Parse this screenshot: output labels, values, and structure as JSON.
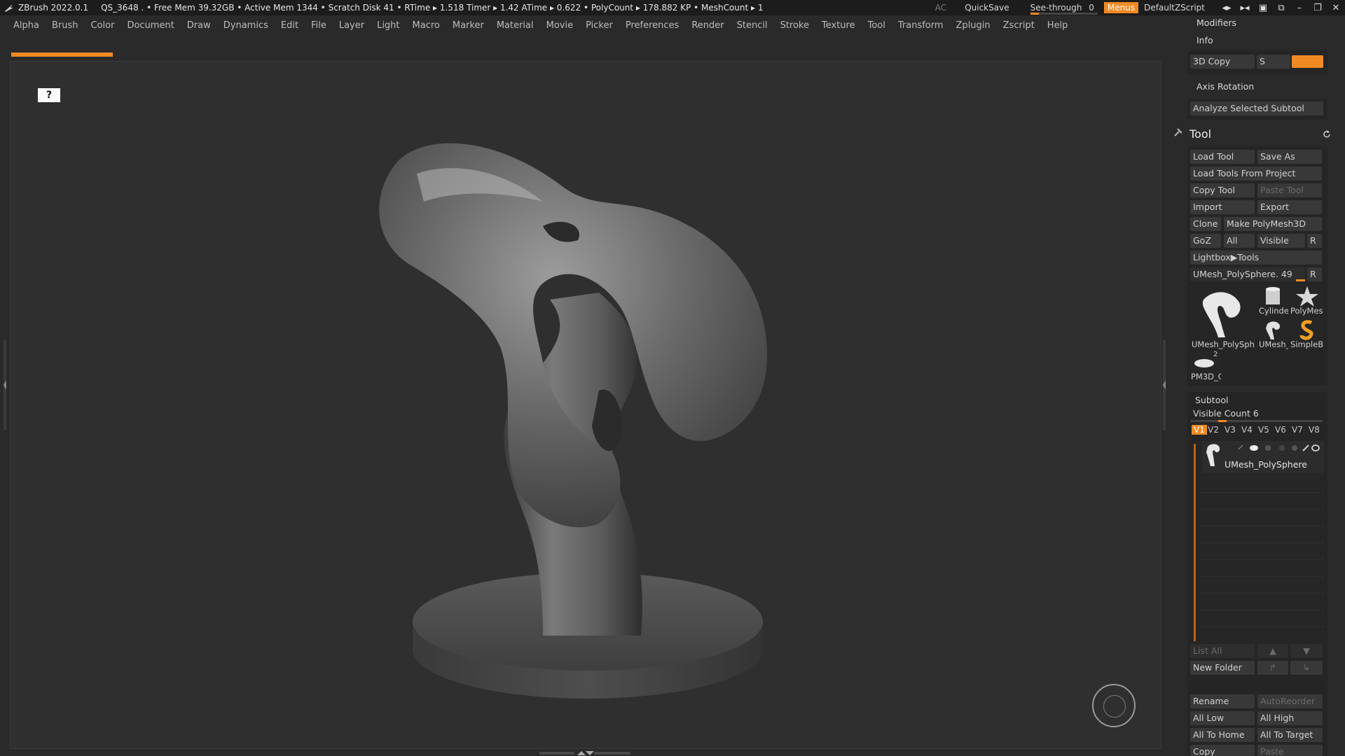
{
  "titlebar": {
    "app_title": "ZBrush 2022.0.1",
    "status": "QS_3648   . • Free Mem 39.32GB • Active Mem 1344 • Scratch Disk 41 • RTime ▸ 1.518 Timer ▸ 1.42 ATime ▸ 0.622 • PolyCount ▸ 178.882 KP • MeshCount ▸ 1",
    "ac": "AC",
    "quicksave": "QuickSave",
    "see_through_label": "See-through",
    "see_through_value": "0",
    "see_through_fraction": 0.0,
    "menus": "Menus",
    "script": "DefaultZScript"
  },
  "menubar": [
    "Alpha",
    "Brush",
    "Color",
    "Document",
    "Draw",
    "Dynamics",
    "Edit",
    "File",
    "Layer",
    "Light",
    "Macro",
    "Marker",
    "Material",
    "Movie",
    "Picker",
    "Preferences",
    "Render",
    "Stencil",
    "Stroke",
    "Texture",
    "Tool",
    "Transform",
    "Zplugin",
    "Zscript",
    "Help"
  ],
  "canvas": {
    "flag_glyph": "?"
  },
  "right_panel": {
    "modifiers": "Modifiers",
    "info": "Info",
    "copy3d": "3D Copy",
    "copy3d_s": "S",
    "axis_rotation": "Axis Rotation",
    "analyze": "Analyze Selected Subtool",
    "tool_title": "Tool",
    "load_tool": "Load Tool",
    "save_as": "Save As",
    "load_from_project": "Load Tools From Project",
    "copy_tool": "Copy Tool",
    "paste_tool": "Paste Tool",
    "import": "Import",
    "export": "Export",
    "clone": "Clone",
    "make_polymesh": "Make PolyMesh3D",
    "goz": "GoZ",
    "all": "All",
    "visible": "Visible",
    "r": "R",
    "lightbox_tools": "Lightbox▶Tools",
    "current_tool": "UMesh_PolySphere. 49",
    "thumbs": [
      {
        "label": "UMesh_PolySphe"
      },
      {
        "label": "Cylinder"
      },
      {
        "label": "PolyMes"
      },
      {
        "label": "UMesh_"
      },
      {
        "label": "SimpleB"
      },
      {
        "label": "PM3D_C"
      }
    ],
    "pm3d_badge": "2",
    "subtool": "Subtool",
    "visible_count": "Visible Count 6",
    "visible_count_fraction": 0.25,
    "v_tabs": [
      "V1",
      "V2",
      "V3",
      "V4",
      "V5",
      "V6",
      "V7",
      "V8"
    ],
    "subtool_item": "UMesh_PolySphere",
    "list_all": "List All",
    "new_folder": "New Folder",
    "rename": "Rename",
    "auto_reorder": "AutoReorder",
    "all_low": "All Low",
    "all_high": "All High",
    "all_to_home": "All To Home",
    "all_to_target": "All To Target",
    "copy": "Copy",
    "paste": "Paste"
  },
  "colors": {
    "accent": "#f08a24",
    "panel": "#2a2a2a",
    "canvas": "#2f2f2f"
  }
}
